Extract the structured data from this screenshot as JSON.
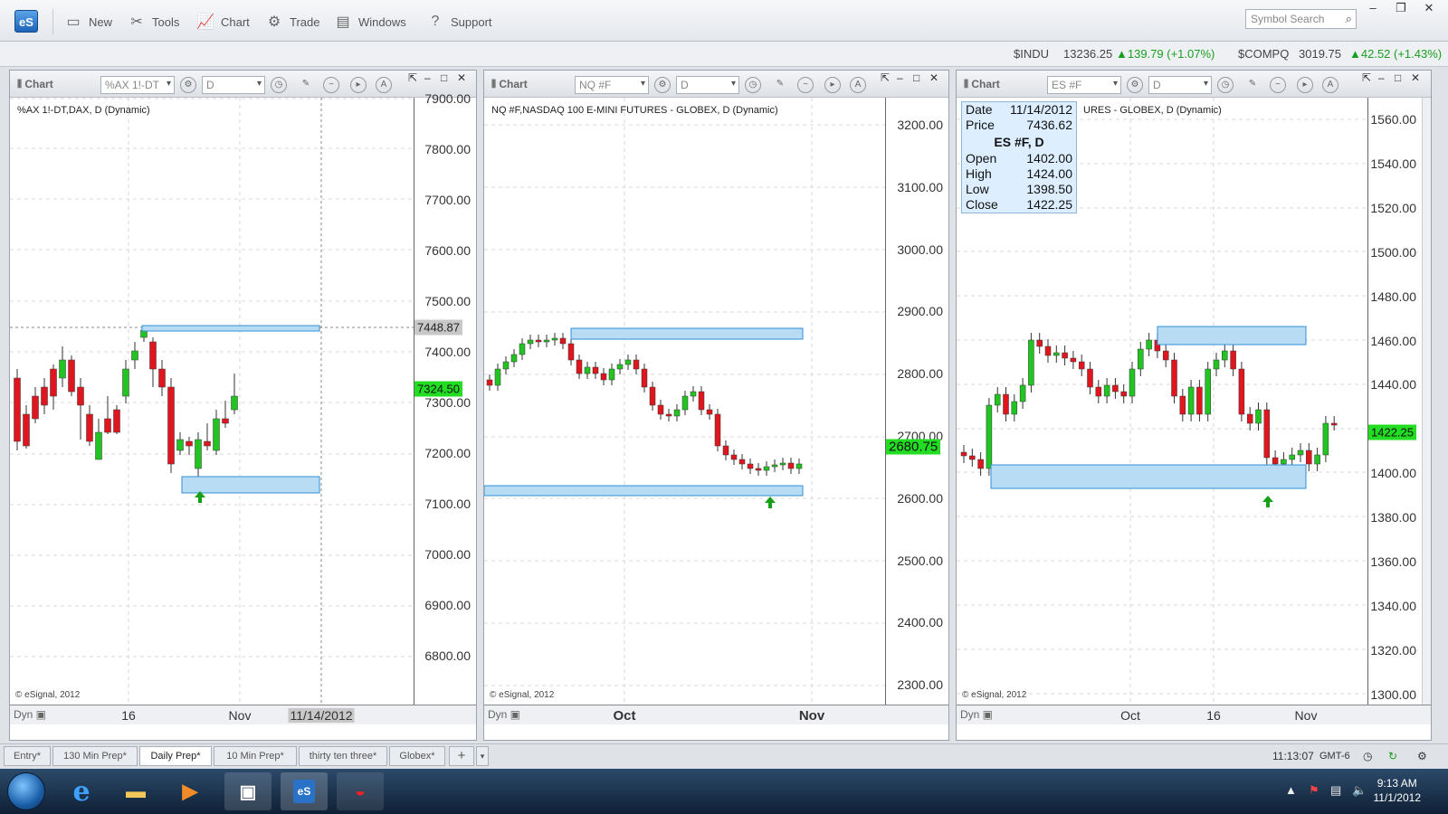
{
  "app": {
    "logo": "eS",
    "symbol_search_placeholder": "Symbol Search"
  },
  "toolbar": {
    "new": "New",
    "tools": "Tools",
    "chart": "Chart",
    "trade": "Trade",
    "windows": "Windows",
    "support": "Support"
  },
  "tickers": [
    {
      "symbol": "$INDU",
      "last": "13236.25",
      "change": "▲139.79 (+1.07%)"
    },
    {
      "symbol": "$COMPQ",
      "last": "3019.75",
      "change": "▲42.52 (+1.43%)"
    }
  ],
  "charts": [
    {
      "header_label": "Chart",
      "symbol": "%AX 1!-DT",
      "interval": "D",
      "title": "%AX 1!-DT,DAX, D (Dynamic)",
      "y_ticks": [
        "7900.00",
        "7800.00",
        "7700.00",
        "7600.00",
        "7500.00",
        "7400.00",
        "7300.00",
        "7200.00",
        "7100.00",
        "7000.00",
        "6900.00",
        "6800.00"
      ],
      "x_ticks": [
        "16",
        "Nov",
        "11/14/2012"
      ],
      "last_price_tag": "7324.50",
      "crosshair_tag": "7448.87",
      "copyright": "© eSignal, 2012",
      "dyn": "Dyn"
    },
    {
      "header_label": "Chart",
      "symbol": "NQ #F",
      "interval": "D",
      "title": "NQ #F,NASDAQ 100 E-MINI FUTURES - GLOBEX, D (Dynamic)",
      "y_ticks": [
        "3200.00",
        "3100.00",
        "3000.00",
        "2900.00",
        "2800.00",
        "2700.00",
        "2600.00",
        "2500.00",
        "2400.00",
        "2300.00"
      ],
      "x_ticks": [
        "Oct",
        "Nov"
      ],
      "last_price_tag": "2680.75",
      "copyright": "© eSignal, 2012",
      "dyn": "Dyn"
    },
    {
      "header_label": "Chart",
      "symbol": "ES #F",
      "interval": "D",
      "title": "URES - GLOBEX, D (Dynamic)",
      "y_ticks": [
        "1560.00",
        "1540.00",
        "1520.00",
        "1500.00",
        "1480.00",
        "1460.00",
        "1440.00",
        "1420.00",
        "1400.00",
        "1380.00",
        "1360.00",
        "1340.00",
        "1320.00",
        "1300.00"
      ],
      "x_ticks": [
        "Oct",
        "16",
        "Nov"
      ],
      "last_price_tag": "1422.25",
      "copyright": "© eSignal, 2012",
      "dyn": "Dyn",
      "info": {
        "date_label": "Date",
        "date": "11/14/2012",
        "price_label": "Price",
        "price": "7436.62",
        "title": "ES #F, D",
        "open_label": "Open",
        "open": "1402.00",
        "high_label": "High",
        "high": "1424.00",
        "low_label": "Low",
        "low": "1398.50",
        "close_label": "Close",
        "close": "1422.25"
      }
    }
  ],
  "tabs": [
    "Entry*",
    "130 Min Prep*",
    "Daily Prep*",
    "10 Min Prep*",
    "thirty ten three*",
    "Globex*",
    "+"
  ],
  "status": {
    "time": "11:13:07",
    "tz": "GMT-6"
  },
  "taskbar": {
    "time": "9:13 AM",
    "date": "11/1/2012"
  },
  "colors": {
    "up": "#22c422",
    "down": "#e0161f",
    "zone": "#b9dcf5",
    "zone_border": "#2f8fd5",
    "price_tag": "#22dd22"
  }
}
